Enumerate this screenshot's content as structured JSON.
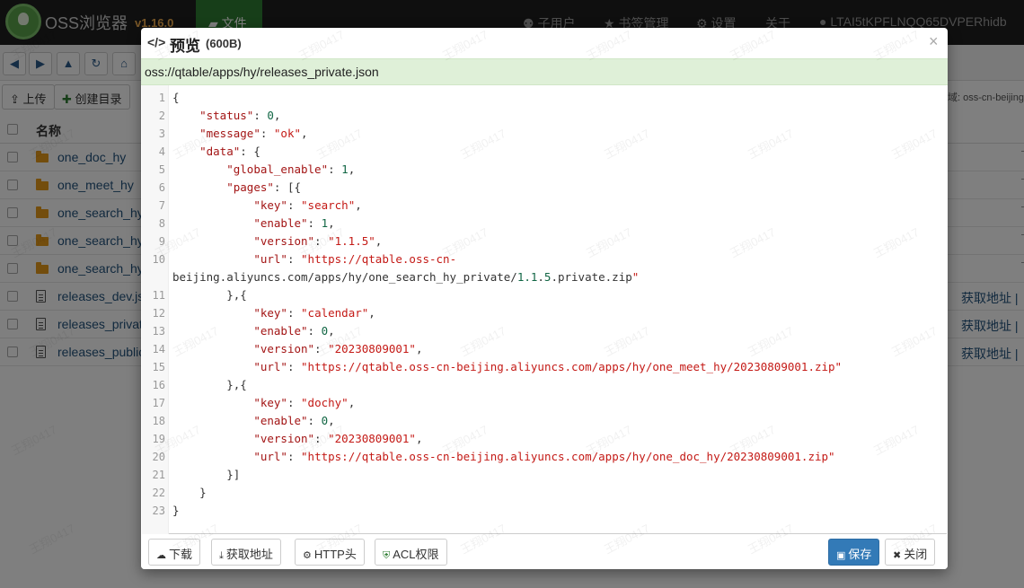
{
  "app": {
    "brand": "OSS浏览器",
    "version": "v1.16.0",
    "logo_icon": "leaf-icon",
    "accent": "#2e7d32"
  },
  "navbar": {
    "file_tab": "文件",
    "sub_users": "子用户",
    "bookmarks": "书签管理",
    "settings": "设置",
    "about": "关于",
    "account": "LTAI5tKPFLNQQ65DVPERhidb"
  },
  "toolbar": {
    "upload": "上传",
    "create_dir": "创建目录",
    "region": "域: oss-cn-beijing"
  },
  "file_list": {
    "name_header": "名称",
    "rows": [
      {
        "name": "one_doc_hy",
        "type": "folder"
      },
      {
        "name": "one_meet_hy",
        "type": "folder"
      },
      {
        "name": "one_search_hy",
        "type": "folder"
      },
      {
        "name": "one_search_hy",
        "type": "folder"
      },
      {
        "name": "one_search_hy",
        "type": "folder"
      },
      {
        "name": "releases_dev.js",
        "type": "file",
        "action": "获取地址 |"
      },
      {
        "name": "releases_privat",
        "type": "file",
        "action": "获取地址 |"
      },
      {
        "name": "releases_public",
        "type": "file",
        "action": "获取地址 |"
      }
    ]
  },
  "modal": {
    "title": "预览",
    "size": "(600B)",
    "path": "oss://qtable/apps/hy/releases_private.json",
    "code_lines": [
      "{",
      "    \"status\": 0,",
      "    \"message\": \"ok\",",
      "    \"data\": {",
      "        \"global_enable\": 1,",
      "        \"pages\": [{",
      "            \"key\": \"search\",",
      "            \"enable\": 1,",
      "            \"version\": \"1.1.5\",",
      "            \"url\": \"https://qtable.oss-cn-",
      "beijing.aliyuncs.com/apps/hy/one_search_hy_private/1.1.5.private.zip\"",
      "        },{",
      "            \"key\": \"calendar\",",
      "            \"enable\": 0,",
      "            \"version\": \"20230809001\",",
      "            \"url\": \"https://qtable.oss-cn-beijing.aliyuncs.com/apps/hy/one_meet_hy/20230809001.zip\"",
      "        },{",
      "            \"key\": \"dochy\",",
      "            \"enable\": 0,",
      "            \"version\": \"20230809001\",",
      "            \"url\": \"https://qtable.oss-cn-beijing.aliyuncs.com/apps/hy/one_doc_hy/20230809001.zip\"",
      "        }]",
      "    }",
      "}"
    ],
    "line_numbers": [
      "1",
      "2",
      "3",
      "4",
      "5",
      "6",
      "7",
      "8",
      "9",
      "10",
      "",
      "11",
      "12",
      "13",
      "14",
      "15",
      "16",
      "17",
      "18",
      "19",
      "20",
      "21",
      "22",
      "23"
    ],
    "buttons": {
      "download": "下载",
      "get_url": "获取地址",
      "http_headers": "HTTP头",
      "acl": "ACL权限",
      "save": "保存",
      "close": "关闭"
    }
  },
  "watermark": "王翔0417"
}
